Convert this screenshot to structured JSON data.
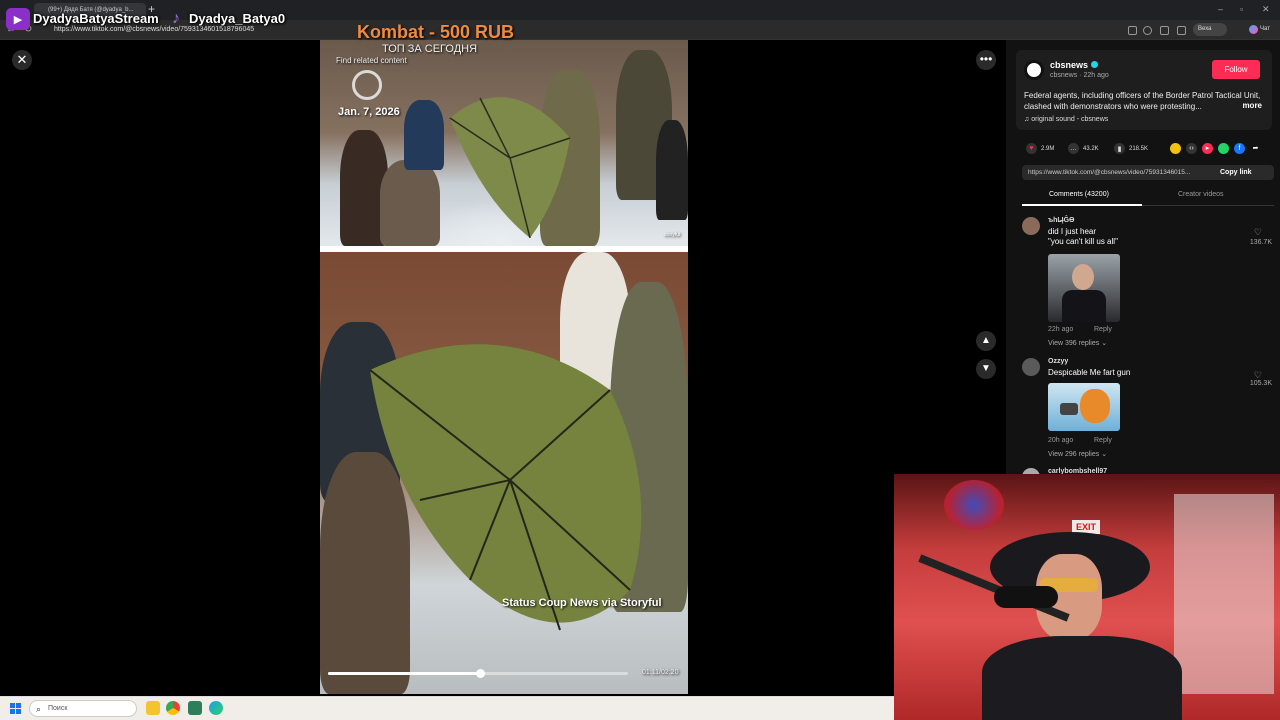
{
  "browser": {
    "tab_title": "(99+) Дядя Батя (@dyadya_b...",
    "new_tab": "+",
    "url": "https://www.tiktok.com/@cbsnews/video/7593134601518796045",
    "profile_label": "Веха",
    "edge_label": "Чат"
  },
  "stream": {
    "name1": "DyadyaBatyaStream",
    "name2": "Dyadya_Batya0",
    "kombat": "Kombat - 500 RUB",
    "top_today": "ТОП ЗА СЕГОДНЯ"
  },
  "video": {
    "find_related": "Find related content",
    "date": "Jan. 7, 2026",
    "source_watermark": "storyful",
    "caption": "Status Coup News via Storyful",
    "time": "01:11/02:20",
    "progress_fraction": 0.507
  },
  "panel": {
    "channel": "cbsnews",
    "channel_sub": "cbsnews · 22h ago",
    "follow": "Follow",
    "description": "Federal agents, including officers of the Border Patrol Tactical Unit, clashed with demonstrators who were protesting...",
    "more": "more",
    "sound": "original sound - cbsnews",
    "likes": "2.9M",
    "comments_count": "43.2K",
    "saves": "218.5K",
    "link": "https://www.tiktok.com/@cbsnews/video/75931346015...",
    "copy_link": "Copy link",
    "tab_comments": "Comments (43200)",
    "tab_creator": "Creator videos",
    "comments": [
      {
        "user": "ъһL̶ĮĜӨ",
        "text": "did I just hear\n\"you can't kill us all\"",
        "likes": "136.7K",
        "time": "22h ago",
        "reply": "Reply",
        "view": "View 396 replies"
      },
      {
        "user": "Ozzyy",
        "text": "Despicable Me fart gun",
        "likes": "105.3K",
        "time": "20h ago",
        "reply": "Reply",
        "view": "View 296 replies"
      },
      {
        "user": "carlybombshell97",
        "text": "",
        "likes": "",
        "time": "",
        "reply": "",
        "view": ""
      }
    ]
  },
  "taskbar": {
    "search_placeholder": "Поиск"
  },
  "colors": {
    "accent_follow": "#fe2c55",
    "kombat_text": "#f08a3c",
    "stream_logo": "#8b2fc9",
    "verified": "#20d5ec"
  },
  "icons": [
    "close-icon",
    "more-icon",
    "chevron-up-icon",
    "chevron-down-icon",
    "heart-icon",
    "comment-icon",
    "bookmark-icon",
    "music-note-icon",
    "search-icon",
    "windows-start-icon"
  ]
}
